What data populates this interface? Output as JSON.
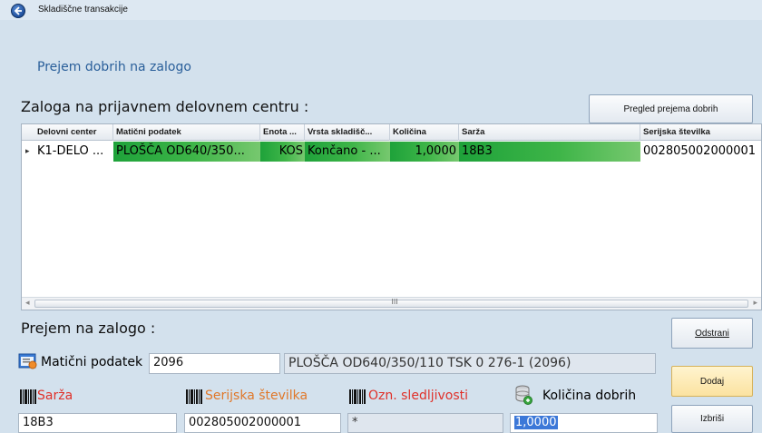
{
  "window": {
    "title": "Skladiščne transakcije"
  },
  "subtitle": "Prejem dobrih na zalogo",
  "stock_section": {
    "title": "Zaloga na prijavnem delovnem centru :",
    "overview_button": "Pregled prejema dobrih"
  },
  "grid": {
    "columns": [
      "Delovni center",
      "Matični podatek",
      "Enota ...",
      "Vrsta skladišč...",
      "Količina",
      "Sarža",
      "Serijska številka"
    ],
    "rows": [
      {
        "work_center": "K1-DELO ...",
        "master_data": "PLOŠČA OD640/350...",
        "unit": "KOS",
        "warehouse_type": "Končano - ...",
        "quantity": "1,0000",
        "batch": "18B3",
        "serial": "002805002000001"
      }
    ],
    "scroll_grip": "III"
  },
  "receipt_section": {
    "title": "Prejem na zalogo :",
    "remove_button": "Odstrani",
    "add_button": "Dodaj",
    "delete_button": "Izbriši",
    "master_data_label": "Matični podatek",
    "master_data_value": "2096",
    "master_data_description": "PLOŠČA OD640/350/110 TSK 0 276-1 (2096)",
    "batch_label": "Sarža",
    "batch_value": "18B3",
    "serial_label": "Serijska številka",
    "serial_value": "002805002000001",
    "traceability_label": "Ozn. sledljivosti",
    "traceability_value": "*",
    "quantity_label": "Količina dobrih",
    "quantity_value": "1,0000"
  },
  "colors": {
    "background": "#d3e1ed",
    "accent_title": "#2a5f9a",
    "row_highlight": "#3eb548",
    "label_red": "#e0312a",
    "label_orange": "#e0782a"
  }
}
